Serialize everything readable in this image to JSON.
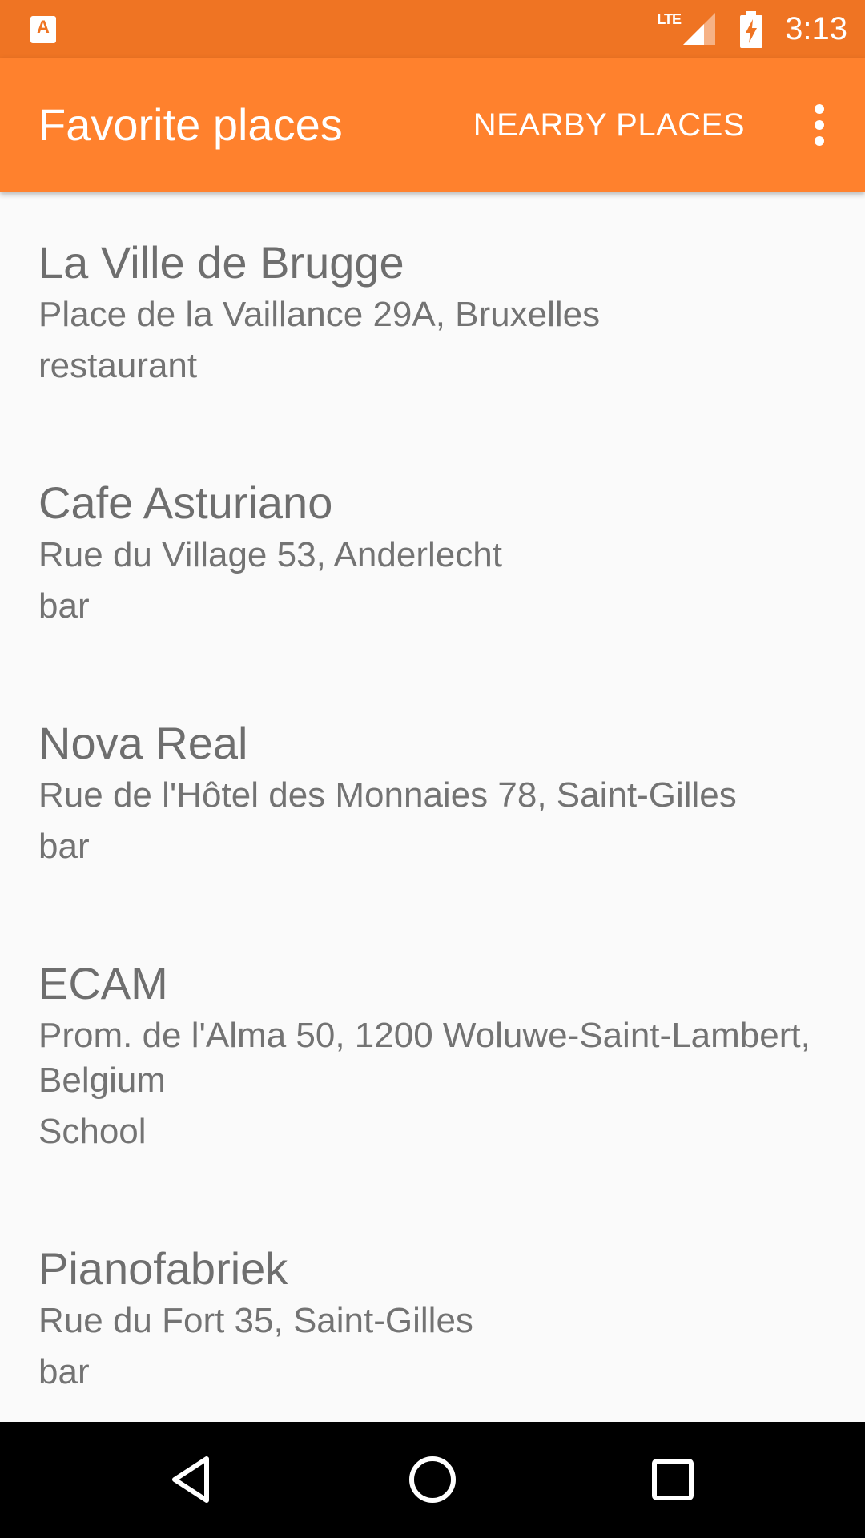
{
  "status_bar": {
    "app_icon": "android-app-icon",
    "network_label": "LTE",
    "signal_icon": "cell-signal-icon",
    "battery_icon": "battery-charging-icon",
    "time": "3:13",
    "color": "#ef7423"
  },
  "app_bar": {
    "title": "Favorite places",
    "nearby_label": "NEARBY PLACES",
    "overflow_icon": "more-vert-icon",
    "color": "#ff812d"
  },
  "places": [
    {
      "name": "La Ville de Brugge",
      "address": "Place de la Vaillance 29A, Bruxelles",
      "type": "restaurant"
    },
    {
      "name": "Cafe Asturiano",
      "address": "Rue du Village 53, Anderlecht",
      "type": "bar"
    },
    {
      "name": "Nova Real",
      "address": "Rue de l'Hôtel des Monnaies 78, Saint-Gilles",
      "type": "bar"
    },
    {
      "name": "ECAM",
      "address": "Prom. de l'Alma 50, 1200 Woluwe-Saint-Lambert, Belgium",
      "type": "School"
    },
    {
      "name": "Pianofabriek",
      "address": "Rue du Fort 35, Saint-Gilles",
      "type": "bar"
    }
  ],
  "nav_bar": {
    "back_icon": "back-triangle-icon",
    "home_icon": "home-circle-icon",
    "recents_icon": "recents-square-icon"
  }
}
